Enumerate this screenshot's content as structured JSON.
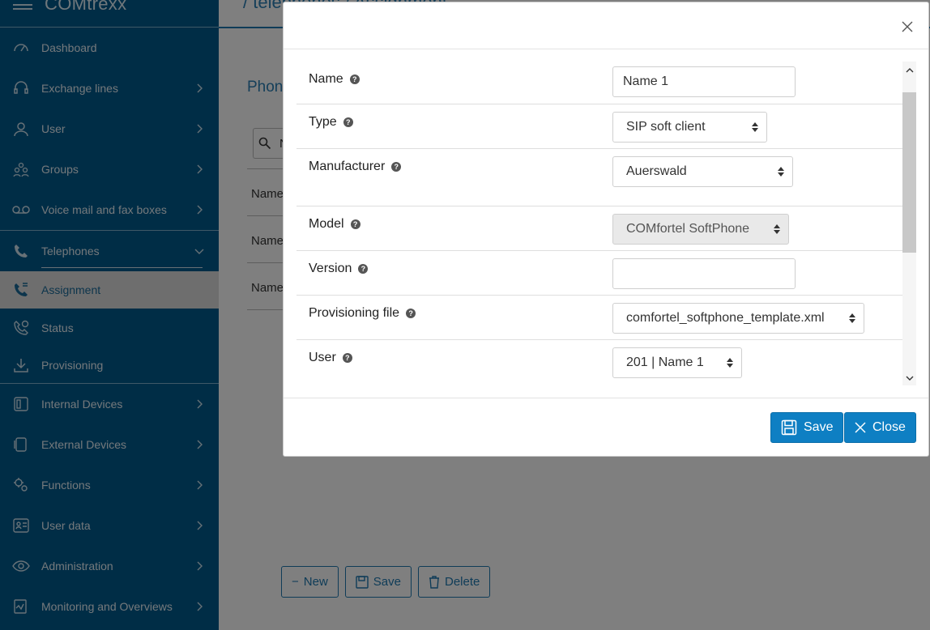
{
  "app": {
    "title": "COMtrexx"
  },
  "sidebar": {
    "items": [
      {
        "label": "Dashboard",
        "icon": "dashboard-icon"
      },
      {
        "label": "Exchange lines",
        "icon": "headset-icon"
      },
      {
        "label": "User",
        "icon": "user-icon"
      },
      {
        "label": "Groups",
        "icon": "groups-icon"
      },
      {
        "label": "Voice mail and fax boxes",
        "icon": "voicemail-icon"
      },
      {
        "label": "Telephones",
        "icon": "phone-icon"
      },
      {
        "label": "Assignment",
        "icon": "phone-assignment-icon"
      },
      {
        "label": "Status",
        "icon": "phone-status-icon"
      },
      {
        "label": "Provisioning",
        "icon": "download-icon"
      },
      {
        "label": "Internal Devices",
        "icon": "internal-devices-icon"
      },
      {
        "label": "External Devices",
        "icon": "external-devices-icon"
      },
      {
        "label": "Functions",
        "icon": "functions-icon"
      },
      {
        "label": "User data",
        "icon": "user-data-icon"
      },
      {
        "label": "Administration",
        "icon": "eye-icon"
      },
      {
        "label": "Monitoring and Overviews",
        "icon": "monitoring-icon"
      }
    ]
  },
  "main": {
    "breadcrumb": "/ telephones / Assignment",
    "heading": "Phon",
    "search_value": "N",
    "col_names": [
      "Name",
      "Name",
      "Name"
    ],
    "buttons": {
      "new": "New",
      "save": "Save",
      "delete": "Delete"
    }
  },
  "modal": {
    "fields": [
      {
        "label": "Name",
        "value": "Name 1",
        "kind": "input"
      },
      {
        "label": "Type",
        "value": "SIP soft client",
        "kind": "select"
      },
      {
        "label": "Manufacturer",
        "value": "Auerswald",
        "kind": "select"
      },
      {
        "label": "Model",
        "value": "COMfortel SoftPhone",
        "kind": "select-disabled"
      },
      {
        "label": "Version",
        "value": "",
        "kind": "input"
      },
      {
        "label": "Provisioning file",
        "value": "comfortel_softphone_template.xml",
        "kind": "select"
      },
      {
        "label": "User",
        "value": "201 | Name 1",
        "kind": "select"
      }
    ],
    "save_label": "Save",
    "close_label": "Close"
  },
  "colors": {
    "sidebar": "#005a8c",
    "accent": "#0e7fc3",
    "active_bg": "#dcdcdc"
  }
}
